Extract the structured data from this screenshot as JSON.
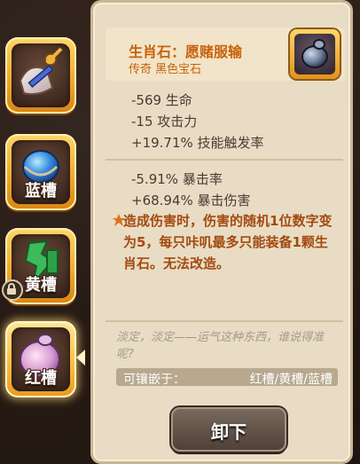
{
  "slots": [
    {
      "id": "weapon",
      "label": "",
      "icon": "weapon-icon",
      "locked": false,
      "active": false
    },
    {
      "id": "blue",
      "label": "蓝槽",
      "icon": "blue-gem-icon",
      "locked": false,
      "active": false
    },
    {
      "id": "yellow",
      "label": "黄槽",
      "icon": "green-gem-icon",
      "locked": true,
      "active": false
    },
    {
      "id": "red",
      "label": "红槽",
      "icon": "potion-gem-icon",
      "locked": false,
      "active": true
    }
  ],
  "item": {
    "name": "生肖石：愿赌服输",
    "subtitle": "传奇 黑色宝石",
    "base_stats": [
      "-569 生命",
      "-15 攻击力",
      "+19.71% 技能触发率"
    ],
    "extra_stats": [
      "-5.91% 暴击率",
      "+68.94% 暴击伤害"
    ],
    "effect": "造成伤害时，伤害的随机1位数字变为5，每只咔叽最多只能装备1颗生肖石。无法改造。",
    "flavor": "淡定，淡定——运气这种东西，谁说得准呢?",
    "socket_label": "可镶嵌于：",
    "socket_value": "红槽/黄槽/蓝槽"
  },
  "buttons": {
    "unequip": "卸下"
  },
  "colors": {
    "title": "#c7620c",
    "effect": "#a34a10",
    "panel": "#e9dcc4"
  }
}
